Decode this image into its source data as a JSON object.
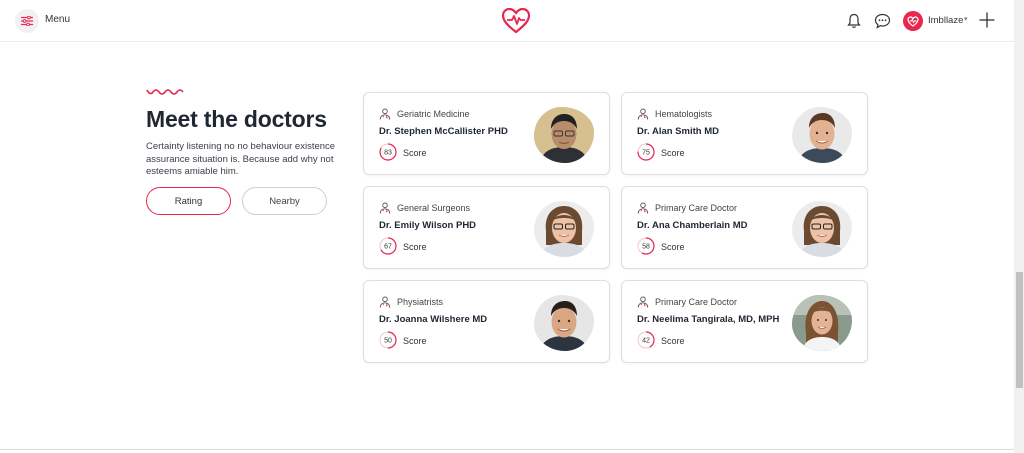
{
  "header": {
    "menu_label": "Menu",
    "menu_icon": "sliders-icon",
    "logo_icon": "heart-pulse-icon",
    "user_name": "Imbllaze",
    "accent": "#e8264e"
  },
  "section": {
    "title": "Meet the doctors",
    "description": "Certainty listening no no behaviour existence assurance situation is. Because add why not esteems amiable him.",
    "filters": [
      {
        "label": "Rating",
        "active": true
      },
      {
        "label": "Nearby",
        "active": false
      }
    ]
  },
  "doctors": [
    {
      "specialty": "Geriatric Medicine",
      "name": "Dr. Stephen McCallister PHD",
      "score": 83,
      "score_label": "Score"
    },
    {
      "specialty": "Hematologists",
      "name": "Dr. Alan Smith MD",
      "score": 75,
      "score_label": "Score"
    },
    {
      "specialty": "General Surgeons",
      "name": "Dr. Emily Wilson PHD",
      "score": 67,
      "score_label": "Score"
    },
    {
      "specialty": "Primary Care Doctor",
      "name": "Dr. Ana Chamberlain MD",
      "score": 58,
      "score_label": "Score"
    },
    {
      "specialty": "Physiatrists",
      "name": "Dr. Joanna Wilshere MD",
      "score": 50,
      "score_label": "Score"
    },
    {
      "specialty": "Primary Care Doctor",
      "name": "Dr. Neelima Tangirala, MD, MPH",
      "score": 42,
      "score_label": "Score"
    }
  ]
}
